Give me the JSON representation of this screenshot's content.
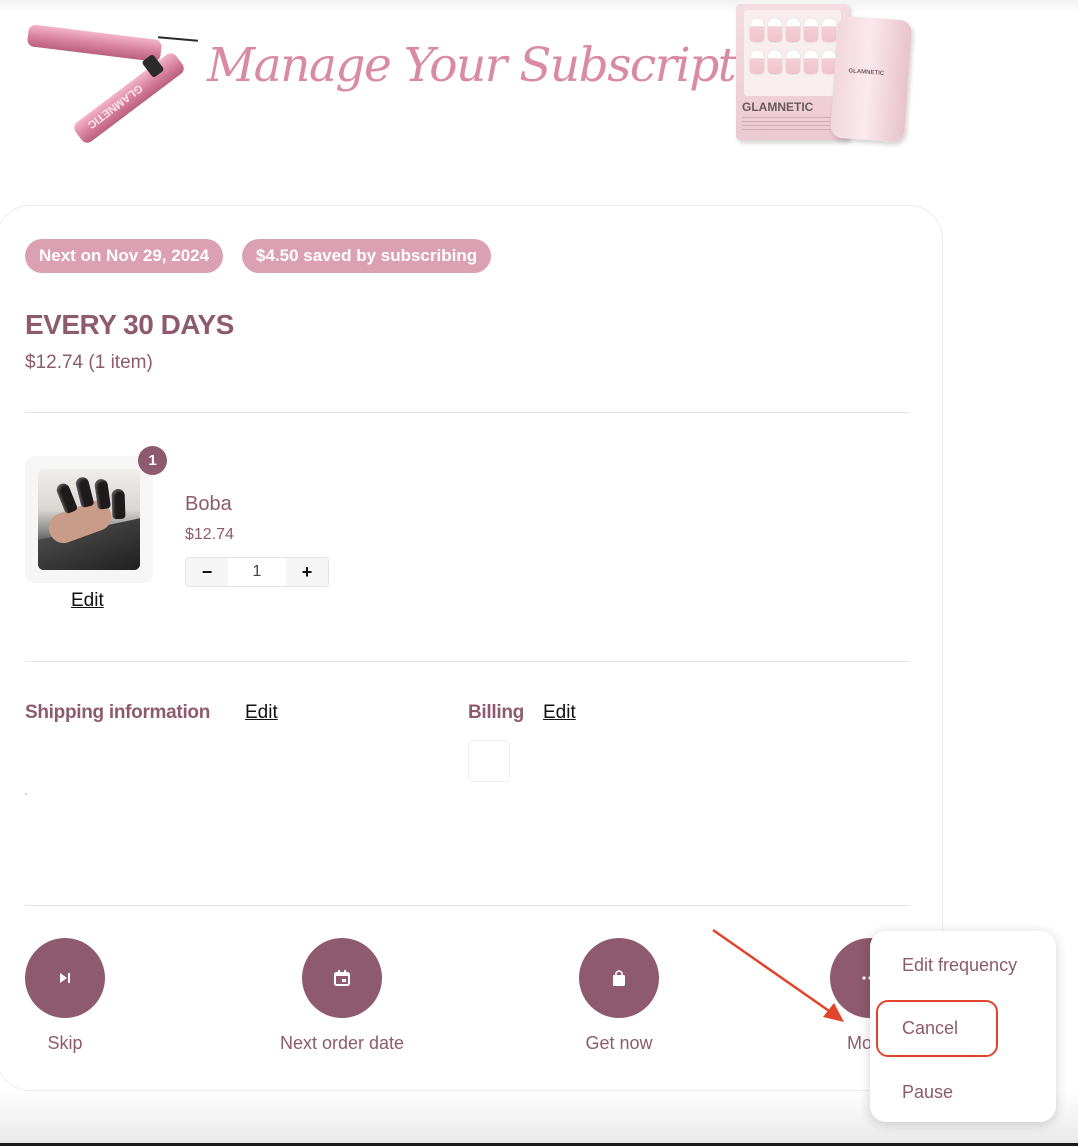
{
  "banner": {
    "title": "Manage Your Subscriptions",
    "pen_brand": "GLAMNETIC",
    "box_brand": "GLAMNETIC",
    "bottle_brand": "GLAMNETIC"
  },
  "subscription": {
    "next_date_pill": "Next on Nov 29, 2024",
    "saved_pill": "$4.50 saved by subscribing",
    "frequency_title": "EVERY 30 DAYS",
    "total": "$12.74 (1 item)"
  },
  "item": {
    "badge_count": "1",
    "name": "Boba",
    "price": "$12.74",
    "quantity": "1",
    "minus_label": "−",
    "plus_label": "+",
    "edit_label": "Edit"
  },
  "shipping": {
    "label": "Shipping information",
    "edit_label": "Edit"
  },
  "billing": {
    "label": "Billing",
    "edit_label": "Edit"
  },
  "actions": {
    "skip": "Skip",
    "next_order_date": "Next order date",
    "get_now": "Get now",
    "more_partial": "Mo"
  },
  "more_menu": {
    "edit_frequency": "Edit frequency",
    "cancel": "Cancel",
    "pause": "Pause"
  },
  "colors": {
    "accent": "#8e5a6e",
    "pill": "#dba0b1",
    "banner_title": "#d98aa5",
    "annotation": "#e0452b"
  }
}
